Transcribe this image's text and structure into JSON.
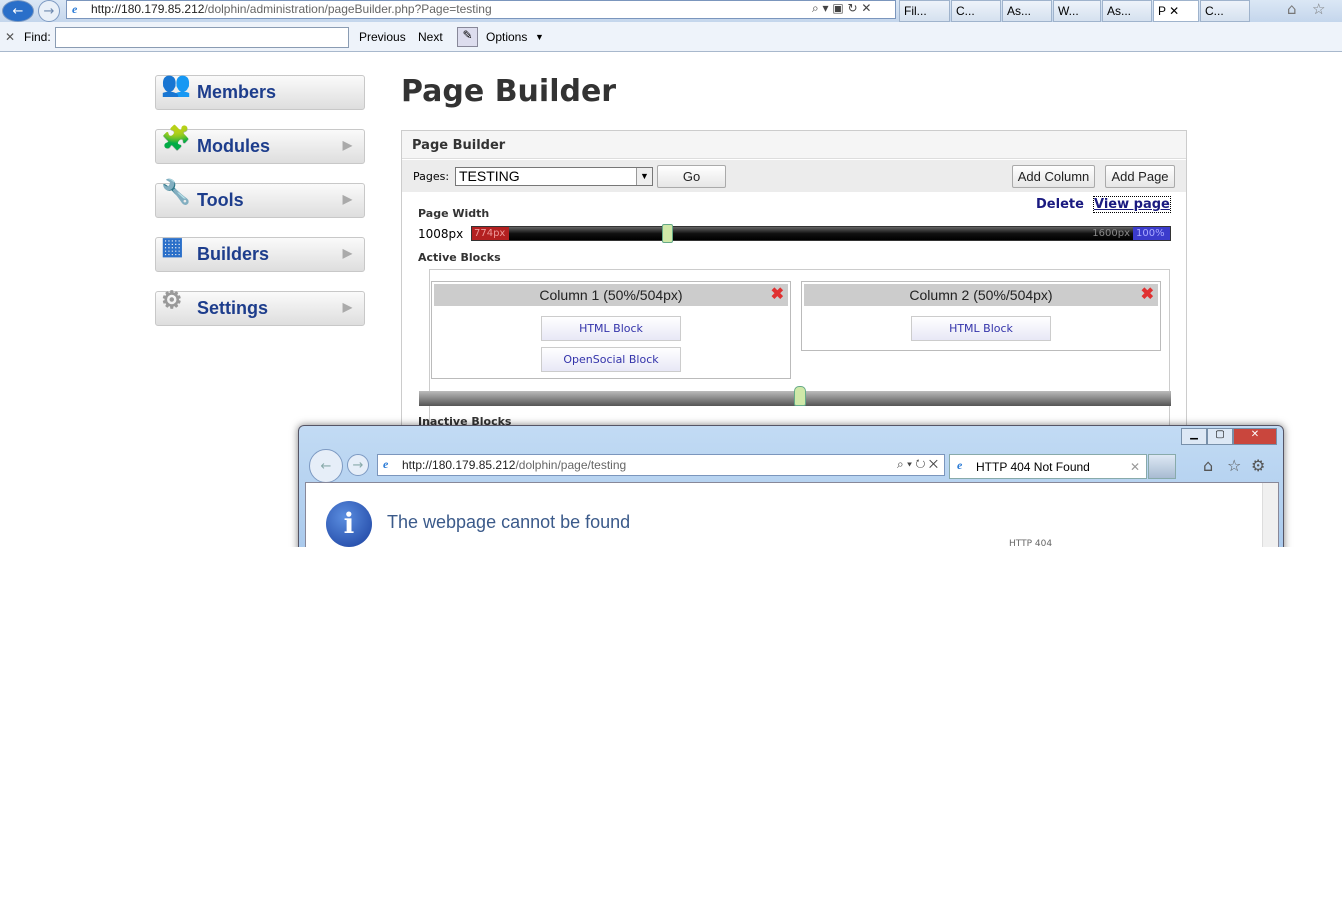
{
  "browser": {
    "url_host": "http://180.179.85.212",
    "url_path": "/dolphin/administration/pageBuilder.php?Page=testing",
    "address_tools": "⌕ ▾ ▣ ↻ ✕",
    "tabs": [
      {
        "label": "Fil..."
      },
      {
        "label": "C..."
      },
      {
        "label": "As..."
      },
      {
        "label": "W..."
      },
      {
        "label": "As..."
      },
      {
        "label": "P",
        "active": true
      },
      {
        "label": "C..."
      }
    ],
    "find": {
      "label": "Find:",
      "value": "",
      "previous": "Previous",
      "next": "Next",
      "options": "Options"
    }
  },
  "sidebar": {
    "items": [
      {
        "label": "Members",
        "icon": "members-icon",
        "glyph": "👥",
        "chevron": false
      },
      {
        "label": "Modules",
        "icon": "puzzle-icon",
        "glyph": "🧩",
        "chevron": true
      },
      {
        "label": "Tools",
        "icon": "wrench-icon",
        "glyph": "🔧",
        "chevron": true
      },
      {
        "label": "Builders",
        "icon": "builders-icon",
        "glyph": "▦",
        "chevron": true
      },
      {
        "label": "Settings",
        "icon": "gear-icon",
        "glyph": "⚙",
        "chevron": true
      }
    ]
  },
  "main": {
    "title": "Page Builder",
    "panel_title": "Page Builder",
    "pages_label": "Pages:",
    "pages_selected": "TESTING",
    "go": "Go",
    "add_column": "Add Column",
    "add_page": "Add Page",
    "delete": "Delete",
    "view_page": "View page",
    "page_width_label": "Page Width",
    "page_width_value": "1008px",
    "slider_min": "774px",
    "slider_max": "1600px",
    "slider_max_pct": "100%",
    "slider_fraction": 0.28,
    "active_blocks": "Active Blocks",
    "inactive_blocks": "Inactive Blocks",
    "columns": [
      {
        "title": "Column 1 (50%/504px)",
        "blocks": [
          "HTML Block",
          "OpenSocial Block"
        ]
      },
      {
        "title": "Column 2 (50%/504px)",
        "blocks": [
          "HTML Block"
        ]
      }
    ]
  },
  "popup": {
    "url_host": "http://180.179.85.212",
    "url_path": "/dolphin/page/testing",
    "tab_title": "HTTP 404 Not Found",
    "heading": "The webpage cannot be found",
    "code": "HTTP 404"
  }
}
